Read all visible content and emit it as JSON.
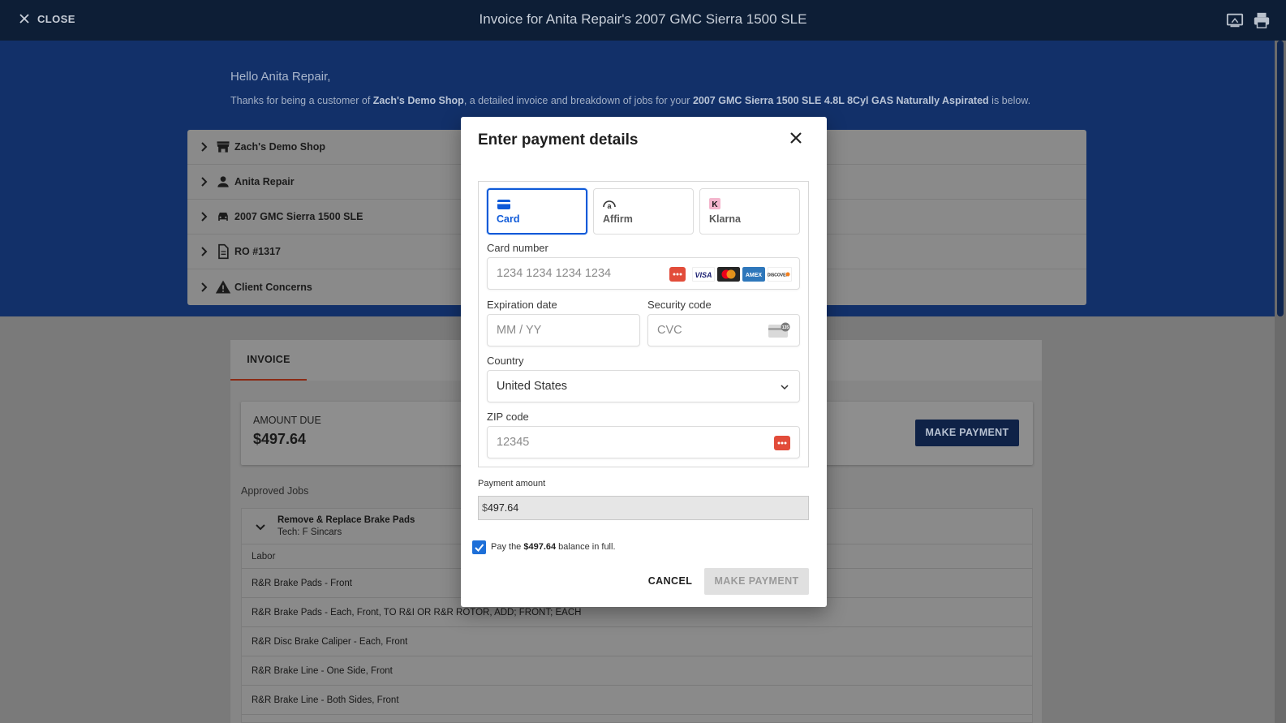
{
  "topbar": {
    "close_label": "CLOSE",
    "title": "Invoice for Anita Repair's 2007 GMC Sierra 1500 SLE",
    "icons": [
      "screen-share-icon",
      "print-icon"
    ]
  },
  "hero": {
    "greeting": "Hello Anita Repair,",
    "intro_pre": "Thanks for being a customer of ",
    "shop_name": "Zach's Demo Shop",
    "intro_mid": ", a detailed invoice and breakdown of jobs for your ",
    "vehicle_full": "2007 GMC Sierra 1500 SLE 4.8L 8Cyl GAS Naturally Aspirated",
    "intro_post": " is below."
  },
  "panels": [
    {
      "label": "Zach's Demo Shop",
      "icon": "store-icon"
    },
    {
      "label": "Anita Repair",
      "icon": "person-icon"
    },
    {
      "label": "2007 GMC Sierra 1500 SLE",
      "icon": "car-icon"
    },
    {
      "label": "RO #1317",
      "icon": "document-icon"
    },
    {
      "label": "Client Concerns",
      "icon": "warning-icon"
    }
  ],
  "tabs": {
    "invoice": "INVOICE"
  },
  "amount": {
    "label": "AMOUNT DUE",
    "value": "$497.64",
    "pay_button": "MAKE PAYMENT"
  },
  "jobs": {
    "section_label": "Approved Jobs",
    "job_title": "Remove & Replace Brake Pads",
    "tech": "Tech: F Sincars",
    "labor_header": "Labor",
    "labor_rows": [
      "R&R Brake Pads - Front",
      "R&R Brake Pads - Each, Front, TO R&I OR R&R ROTOR, ADD; FRONT; EACH",
      "R&R Disc Brake Caliper - Each, Front",
      "R&R Brake Line - One Side, Front",
      "R&R Brake Line - Both Sides, Front"
    ]
  },
  "modal": {
    "title": "Enter payment details",
    "methods": {
      "card": "Card",
      "affirm": "Affirm",
      "klarna": "Klarna"
    },
    "card_number_label": "Card number",
    "card_number_placeholder": "1234 1234 1234 1234",
    "card_brands": [
      "visa",
      "mastercard",
      "amex",
      "discover"
    ],
    "expiration_label": "Expiration date",
    "expiration_placeholder": "MM / YY",
    "security_label": "Security code",
    "security_placeholder": "CVC",
    "cvc_hint": "135",
    "country_label": "Country",
    "country_value": "United States",
    "zip_label": "ZIP code",
    "zip_placeholder": "12345",
    "payment_amount_label": "Payment amount",
    "currency_symbol": "$",
    "payment_amount_value": "497.64",
    "checkbox_checked": true,
    "pay_full_pre": "Pay the ",
    "pay_full_amount": "$497.64",
    "pay_full_post": " balance in full.",
    "cancel_label": "CANCEL",
    "make_payment_label": "MAKE PAYMENT"
  },
  "colors": {
    "topbar": "#0d1e36",
    "hero": "#123069",
    "accent": "#0f5ad8",
    "tab_underline": "#8b2a14"
  }
}
